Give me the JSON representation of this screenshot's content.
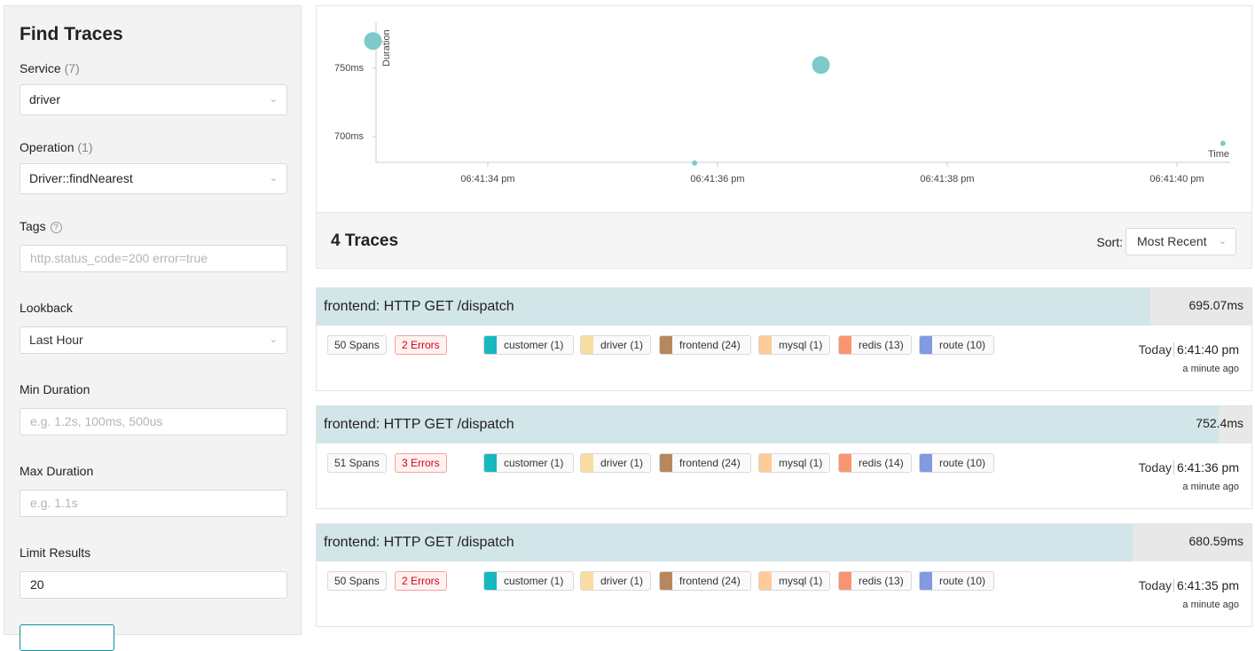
{
  "search": {
    "title": "Find Traces",
    "service_label": "Service",
    "service_count": "(7)",
    "service_value": "driver",
    "operation_label": "Operation",
    "operation_count": "(1)",
    "operation_value": "Driver::findNearest",
    "tags_label": "Tags",
    "tags_help": "?",
    "tags_placeholder": "http.status_code=200 error=true",
    "lookback_label": "Lookback",
    "lookback_value": "Last Hour",
    "min_duration_label": "Min Duration",
    "min_duration_placeholder": "e.g. 1.2s, 100ms, 500us",
    "max_duration_label": "Max Duration",
    "max_duration_placeholder": "e.g. 1.1s",
    "limit_label": "Limit Results",
    "limit_value": "20"
  },
  "chart_data": {
    "type": "scatter",
    "xlabel": "Time",
    "ylabel": "Duration",
    "x_ticks": [
      "06:41:34 pm",
      "06:41:36 pm",
      "06:41:38 pm",
      "06:41:40 pm"
    ],
    "y_ticks": [
      "700ms",
      "750ms"
    ],
    "points": [
      {
        "x": "06:41:33.0 pm",
        "y": 770,
        "size": "large"
      },
      {
        "x": "06:41:35.8 pm",
        "y": 680.59,
        "size": "small"
      },
      {
        "x": "06:41:36.9 pm",
        "y": 752.4,
        "size": "large"
      },
      {
        "x": "06:41:40.4 pm",
        "y": 695.07,
        "size": "small"
      }
    ],
    "color": "#7ec9c9"
  },
  "results": {
    "count_label": "4 Traces",
    "sort_label": "Sort:",
    "sort_value": "Most Recent"
  },
  "traces": [
    {
      "title": "frontend: HTTP GET /dispatch",
      "duration": "695.07ms",
      "bar_fraction": 0.892,
      "spans": "50 Spans",
      "errors": "2 Errors",
      "services": [
        "customer (1)",
        "driver (1)",
        "frontend (24)",
        "mysql (1)",
        "redis (13)",
        "route (10)"
      ],
      "day": "Today",
      "time": "6:41:40 pm",
      "ago": "a minute ago"
    },
    {
      "title": "frontend: HTTP GET /dispatch",
      "duration": "752.4ms",
      "bar_fraction": 0.965,
      "spans": "51 Spans",
      "errors": "3 Errors",
      "services": [
        "customer (1)",
        "driver (1)",
        "frontend (24)",
        "mysql (1)",
        "redis (14)",
        "route (10)"
      ],
      "day": "Today",
      "time": "6:41:36 pm",
      "ago": "a minute ago"
    },
    {
      "title": "frontend: HTTP GET /dispatch",
      "duration": "680.59ms",
      "bar_fraction": 0.873,
      "spans": "50 Spans",
      "errors": "2 Errors",
      "services": [
        "customer (1)",
        "driver (1)",
        "frontend (24)",
        "mysql (1)",
        "redis (13)",
        "route (10)"
      ],
      "day": "Today",
      "time": "6:41:35 pm",
      "ago": "a minute ago"
    }
  ],
  "service_colors": [
    "#17b8be",
    "#f8dca1",
    "#b7885e",
    "#ffcb99",
    "#f89570",
    "#829ae3"
  ]
}
